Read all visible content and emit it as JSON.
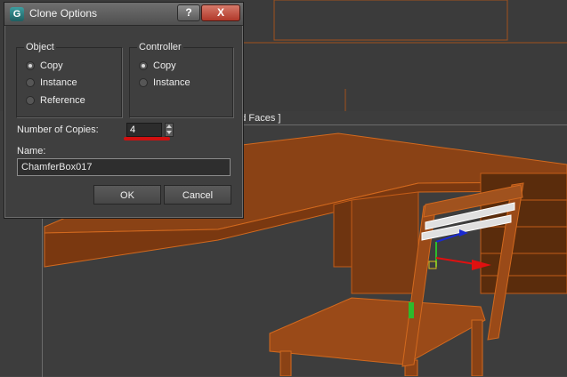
{
  "dialog": {
    "title": "Clone Options",
    "app_icon": "G",
    "help_label": "?",
    "close_label": "X",
    "object_group": {
      "label": "Object",
      "options": [
        "Copy",
        "Instance",
        "Reference"
      ],
      "selected": "Copy"
    },
    "controller_group": {
      "label": "Controller",
      "options": [
        "Copy",
        "Instance"
      ],
      "selected": "Copy"
    },
    "copies_label": "Number of Copies:",
    "copies_value": "4",
    "name_label": "Name:",
    "name_value": "ChamferBox017",
    "ok_label": "OK",
    "cancel_label": "Cancel"
  },
  "viewport": {
    "label": "ged Faces ]"
  },
  "colors": {
    "highlight": "#d01010",
    "wood": "#a9531e",
    "wood_edge": "#d2691e",
    "close_button": "#b1382a"
  },
  "icons": [
    "app-logo-icon",
    "help-icon",
    "close-icon",
    "spin-up-icon",
    "spin-down-icon",
    "gizmo-icon"
  ]
}
